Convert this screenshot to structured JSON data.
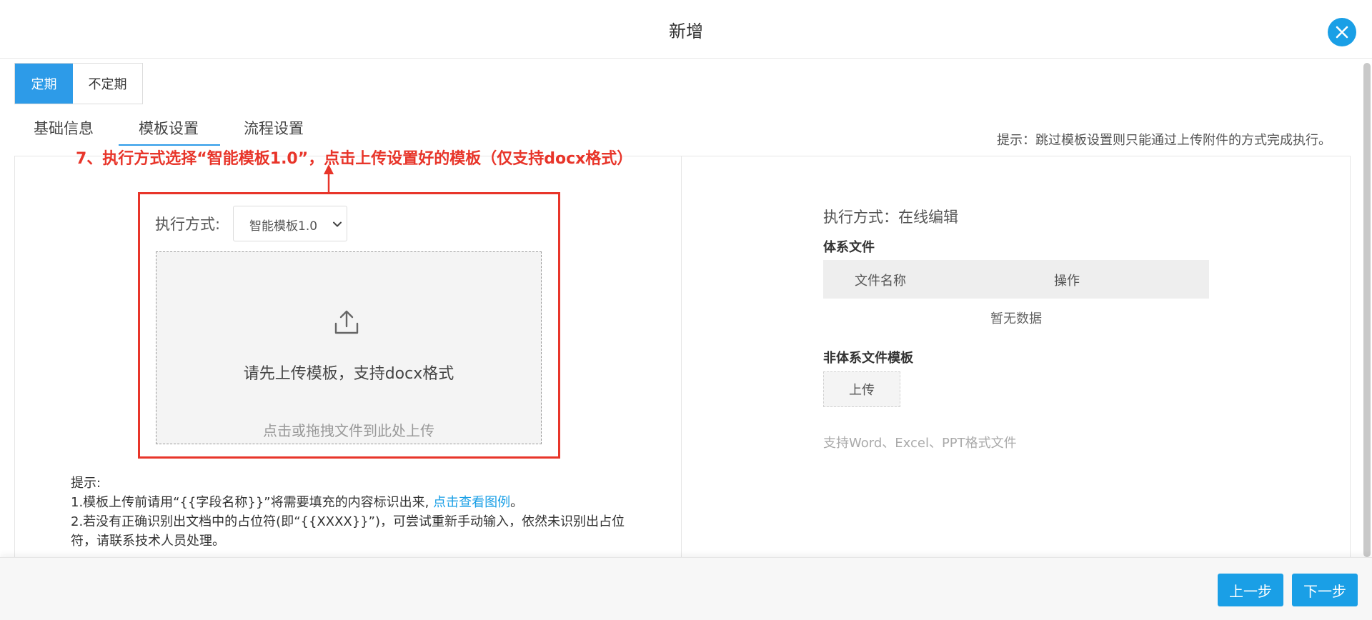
{
  "dialog": {
    "title": "新增"
  },
  "period": {
    "options": [
      "定期",
      "不定期"
    ],
    "selected": "定期"
  },
  "tabs": [
    {
      "label": "基础信息"
    },
    {
      "label": "模板设置"
    },
    {
      "label": "流程设置"
    }
  ],
  "active_tab": "模板设置",
  "hint_right": "提示：跳过模板设置则只能通过上传附件的方式完成执行。",
  "annotation": {
    "text": "7、执行方式选择“智能模板1.0”，点击上传设置好的模板（仅支持docx格式）",
    "color": "#e8352a"
  },
  "left": {
    "exec_label": "执行方式:",
    "exec_value": "智能模板1.0",
    "upload_main": "请先上传模板，支持docx格式",
    "upload_sub": "点击或拖拽文件到此处上传",
    "tips_title": "提示:",
    "tip1_prefix": "1.模板上传前请用“{{字段名称}}”将需要填充的内容标识出来, ",
    "tip1_link": "点击查看图例",
    "tip1_suffix": "。",
    "tip2": "2.若没有正确识别出文档中的占位符(即“{{XXXX}}”)，可尝试重新手动输入，依然未识别出占位符，请联系技术人员处理。"
  },
  "right": {
    "exec_label": "执行方式：在线编辑",
    "system_files_title": "体系文件",
    "col_filename": "文件名称",
    "col_action": "操作",
    "empty_text": "暂无数据",
    "non_system_title": "非体系文件模板",
    "upload_button": "上传",
    "support_text": "支持Word、Excel、PPT格式文件"
  },
  "footer": {
    "prev": "上一步",
    "next": "下一步"
  },
  "colors": {
    "accent": "#1a9fe6",
    "annotation": "#e8352a"
  }
}
